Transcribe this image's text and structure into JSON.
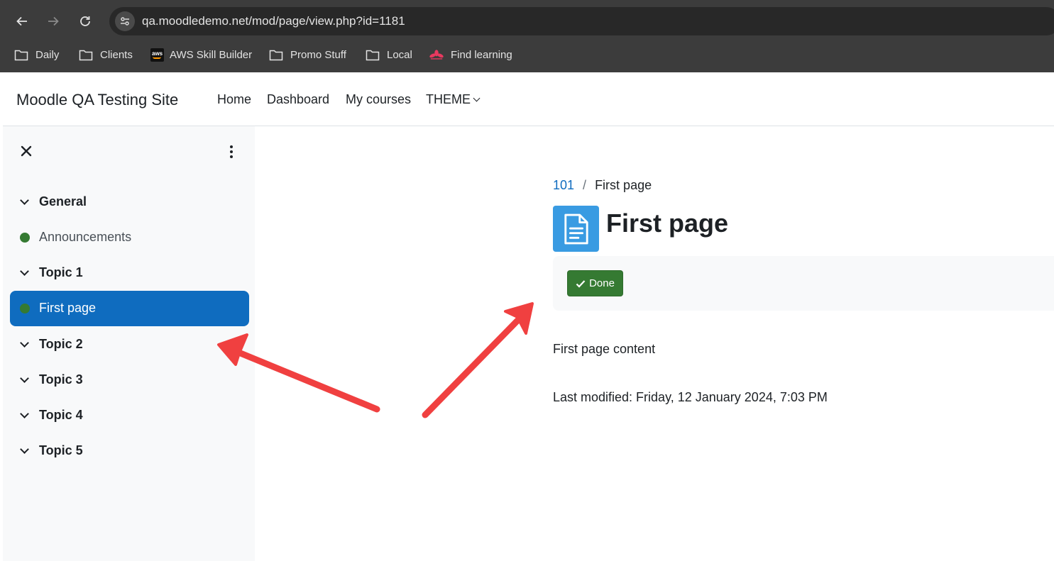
{
  "browser": {
    "url": "qa.moodledemo.net/mod/page/view.php?id=1181",
    "bookmarks": [
      {
        "label": "Daily",
        "icon": "folder-icon"
      },
      {
        "label": "Clients",
        "icon": "folder-icon"
      },
      {
        "label": "AWS Skill Builder",
        "icon": "aws-icon"
      },
      {
        "label": "Promo Stuff",
        "icon": "folder-icon"
      },
      {
        "label": "Local",
        "icon": "folder-icon"
      },
      {
        "label": "Find learning",
        "icon": "flower-icon"
      }
    ]
  },
  "header": {
    "site_name": "Moodle QA Testing Site",
    "nav": [
      "Home",
      "Dashboard",
      "My courses",
      "THEME"
    ]
  },
  "course_index": {
    "items": [
      {
        "label": "General",
        "type": "section"
      },
      {
        "label": "Announcements",
        "type": "activity"
      },
      {
        "label": "Topic 1",
        "type": "section"
      },
      {
        "label": "First page",
        "type": "activity",
        "active": true
      },
      {
        "label": "Topic 2",
        "type": "section"
      },
      {
        "label": "Topic 3",
        "type": "section"
      },
      {
        "label": "Topic 4",
        "type": "section"
      },
      {
        "label": "Topic 5",
        "type": "section"
      }
    ]
  },
  "breadcrumb": {
    "parent": "101",
    "separator": "/",
    "current": "First page"
  },
  "page": {
    "title": "First page",
    "done_label": "Done",
    "content": "First page content",
    "last_modified": "Last modified: Friday, 12 January 2024, 7:03 PM"
  },
  "colors": {
    "primary": "#0f6cbf",
    "success": "#357a32",
    "page_icon": "#399be2",
    "annotation_arrow": "#f04040"
  }
}
